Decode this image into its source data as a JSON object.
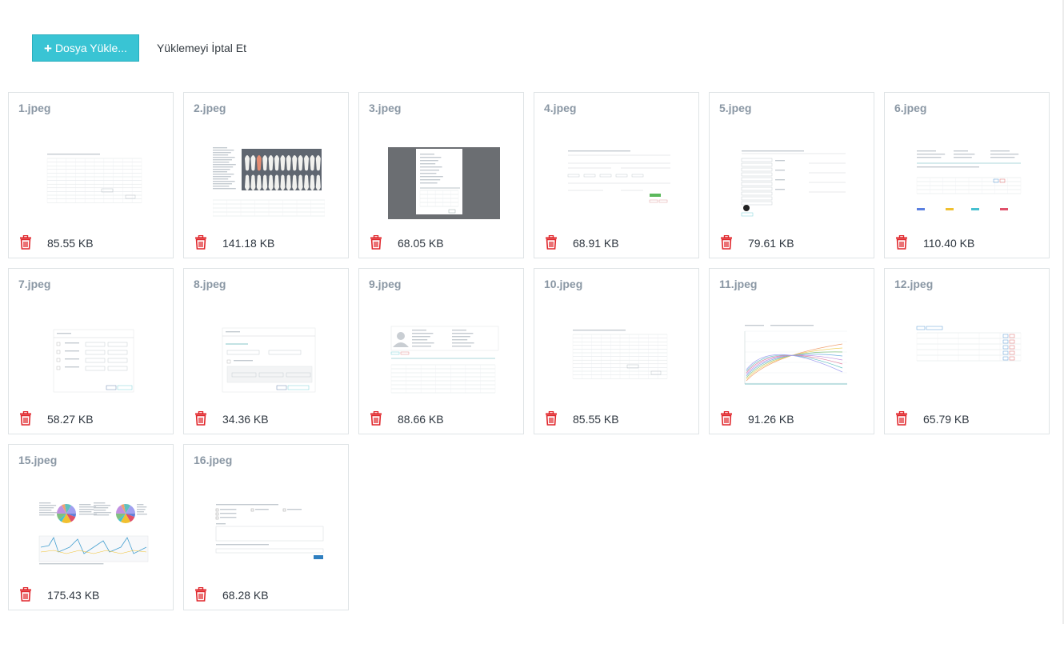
{
  "toolbar": {
    "upload_label": "Dosya Yükle...",
    "cancel_label": "Yüklemeyi İptal Et"
  },
  "colors": {
    "accent": "#39c4d4",
    "delete": "#e0262b",
    "filename": "#8a97a4"
  },
  "files": [
    {
      "name": "1.jpeg",
      "size": "85.55 KB",
      "thumb": "table"
    },
    {
      "name": "2.jpeg",
      "size": "141.18 KB",
      "thumb": "teeth"
    },
    {
      "name": "3.jpeg",
      "size": "68.05 KB",
      "thumb": "dark-modal"
    },
    {
      "name": "4.jpeg",
      "size": "68.91 KB",
      "thumb": "form"
    },
    {
      "name": "5.jpeg",
      "size": "79.61 KB",
      "thumb": "form-list"
    },
    {
      "name": "6.jpeg",
      "size": "110.40 KB",
      "thumb": "detail"
    },
    {
      "name": "7.jpeg",
      "size": "58.27 KB",
      "thumb": "modal"
    },
    {
      "name": "8.jpeg",
      "size": "34.36 KB",
      "thumb": "modal-tabs"
    },
    {
      "name": "9.jpeg",
      "size": "88.66 KB",
      "thumb": "profile"
    },
    {
      "name": "10.jpeg",
      "size": "85.55 KB",
      "thumb": "table"
    },
    {
      "name": "11.jpeg",
      "size": "91.26 KB",
      "thumb": "line-chart"
    },
    {
      "name": "12.jpeg",
      "size": "65.79 KB",
      "thumb": "small-table"
    },
    {
      "name": "15.jpeg",
      "size": "175.43 KB",
      "thumb": "pies"
    },
    {
      "name": "16.jpeg",
      "size": "68.28 KB",
      "thumb": "survey"
    }
  ]
}
